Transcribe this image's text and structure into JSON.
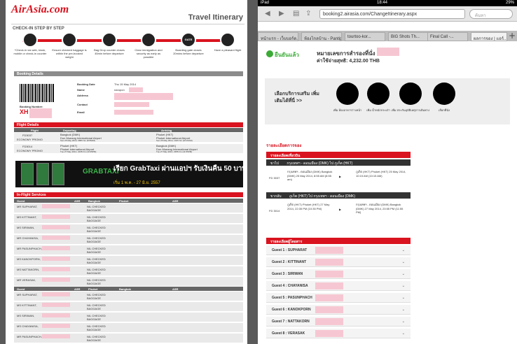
{
  "doc": {
    "logo": "AirAsia.com",
    "title": "Travel Itinerary",
    "checkin_title": "CHECK-IN STEP BY STEP",
    "steps": [
      "*Check-in via web, kiosk, mobile or check-in counter",
      "Ensure checked baggage is within the pre-booked weight",
      "Bag Drop counter closes 45min before departure",
      "Clear immigration and security as early as possible",
      "Boarding gate closes 20mins before departure",
      "Have a pleasant flight"
    ],
    "gate_label": "GATE",
    "booking_details_label": "Booking Details",
    "booking": {
      "date_label": "Booking Date",
      "date_value": "Thu 15 May 2014",
      "name_label": "Name",
      "name_value": "narupon",
      "address_label": "Address",
      "contact_label": "Contact",
      "email_label": "Email",
      "booking_number_label": "Booking Number:",
      "booking_number": "XH"
    },
    "flight_details_label": "Flight Details",
    "flight_header": {
      "flight": "Flight",
      "departing": "Departing",
      "arriving": "Arriving"
    },
    "flights": [
      {
        "code": "FD3037",
        "fare": "ECONOMY PROMO",
        "dep_city": "Bangkok (DMK)",
        "dep_airport": "Don Mueang International Airport",
        "dep_time": "Sun 25 May 2014, 0855 hrs (8:55AM)",
        "arr_city": "Phuket (HKT)",
        "arr_airport": "Phuket International Airport",
        "arr_time": "Sun 25 May 2014, 1015 hrs (10:15AM)"
      },
      {
        "code": "FD3014",
        "fare": "ECONOMY PROMO",
        "dep_city": "Phuket (HKT)",
        "dep_airport": "Phuket International Airport",
        "dep_time": "Tue 27 May 2014, 2235 hrs (10:35PM)",
        "arr_city": "Bangkok (DMK)",
        "arr_airport": "Don Mueang International Airport",
        "arr_time": "Tue 27 May 2014, 2355 hrs (11:55PM)"
      }
    ],
    "banner": {
      "brand": "GRABTAXI",
      "text": "เรียก GrabTaxi ผ่านแอปฯ รับเงินคืน 50 บาท",
      "sub": "เริ่ม 1 พ.ค. - 27 มิ.ย. 2557"
    },
    "inflight_label": "In-Flight Services",
    "guest_header": {
      "guest": "Guest",
      "asr": "ASR",
      "route1_from": "Bangkok",
      "route1_to": "Phuket",
      "route2_from": "Phuket",
      "route2_to": "Bangkok"
    },
    "service_text": "NIL CHECKED BAGGAGE",
    "guests": [
      "MR SUPHARAT,",
      "MS KITTINANT,",
      "MS SIRIWAN,",
      "MR CHAYANISA,",
      "MR PASUNPHACH,",
      "MS KANOKPORN,",
      "MS NATTAKORN,",
      "MR VERASAK,"
    ],
    "guests2": [
      "MR SUPHARAT,",
      "MS KITTINANT,",
      "MS SIRIWAN,",
      "MS CHAYANISA,",
      "MR PASUNPHACH,"
    ]
  },
  "ipad": {
    "status": {
      "device": "iPad",
      "time": "18:44",
      "battery": "29%"
    },
    "url": "booking2.airasia.com/ChangeItinerary.aspx",
    "search_placeholder": "ค้นหา",
    "tabs": [
      "หน้าแรก - เว็บบอร์ด...",
      "ห้องไกลบ้าน - Pantip",
      "tourtoo-kor...",
      "BIG Shots Th...",
      "Final Call -...",
      "ผลการจอง | แอร์..."
    ],
    "confirmed_label": "ยืนยันแล้ว",
    "booking_no_label": "หมายเลขการสำรองที่นั่ง : XH",
    "total_label": "ค่าใช้จ่ายสุทธิ: 4,232.00 THB",
    "services_label": "เลือกบริการเสริม เพิ่มเติมได้ที่นี่ >>",
    "services": [
      "เพิ่ม ห้องอาหารว่างหน้า",
      "เพิ่ม น้ำหนักกระเป๋า",
      "เพิ่ม ประกันอุบัติเหตุการเดินทาง",
      "เลือกที่นั่ง"
    ],
    "booking_details_title": "รายละเอียดการจอง",
    "flight_section_label": "รายละเอียดเที่ยวบิน",
    "legs": [
      {
        "dir": "ขาไป",
        "route": "กรุงเทพฯ - ดอนเมือง (DMK) ไป ภูเก็ต (HKT)",
        "code": "FD 3037",
        "from": "กรุงเทพฯ - ดอนเมือง (DMK) Bangkok (DMK) 25 May 2014, 8:55 AM (8:55 am)",
        "to": "ภูเก็ต (HKT) Phuket (HKT) 25 May 2014, 10:15 AM (10:15 AM)"
      },
      {
        "dir": "ขากลับ",
        "route": "ภูเก็ต (HKT) ไป กรุงเทพฯ - ดอนเมือง (DMK)",
        "code": "FD 3014",
        "from": "ภูเก็ต (HKT) Phuket (HKT) 27 May 2014, 22:35 PM (10:35 PM)",
        "to": "กรุงเทพฯ - ดอนเมือง (DMK) Bangkok (DMK) 27 May 2014, 23:55 PM (11:55 PM)"
      }
    ],
    "guest_section_label": "รายละเอียดผู้โดยสาร",
    "guests": [
      "Guest 1 : SUPHARAT",
      "Guest 2 : KITTINANT",
      "Guest 3 : SIRIWAN",
      "Guest 4 : CHAYANISA",
      "Guest 5 : PASUNPHACH",
      "Guest 6 : KANOKPORN",
      "Guest 7 : NATTAKORN",
      "Guest 8 : VERASAK"
    ]
  },
  "colors": {
    "brand_red": "#d9131f",
    "confirm_green": "#3bab36",
    "redaction_pink": "#f6c7d2"
  }
}
